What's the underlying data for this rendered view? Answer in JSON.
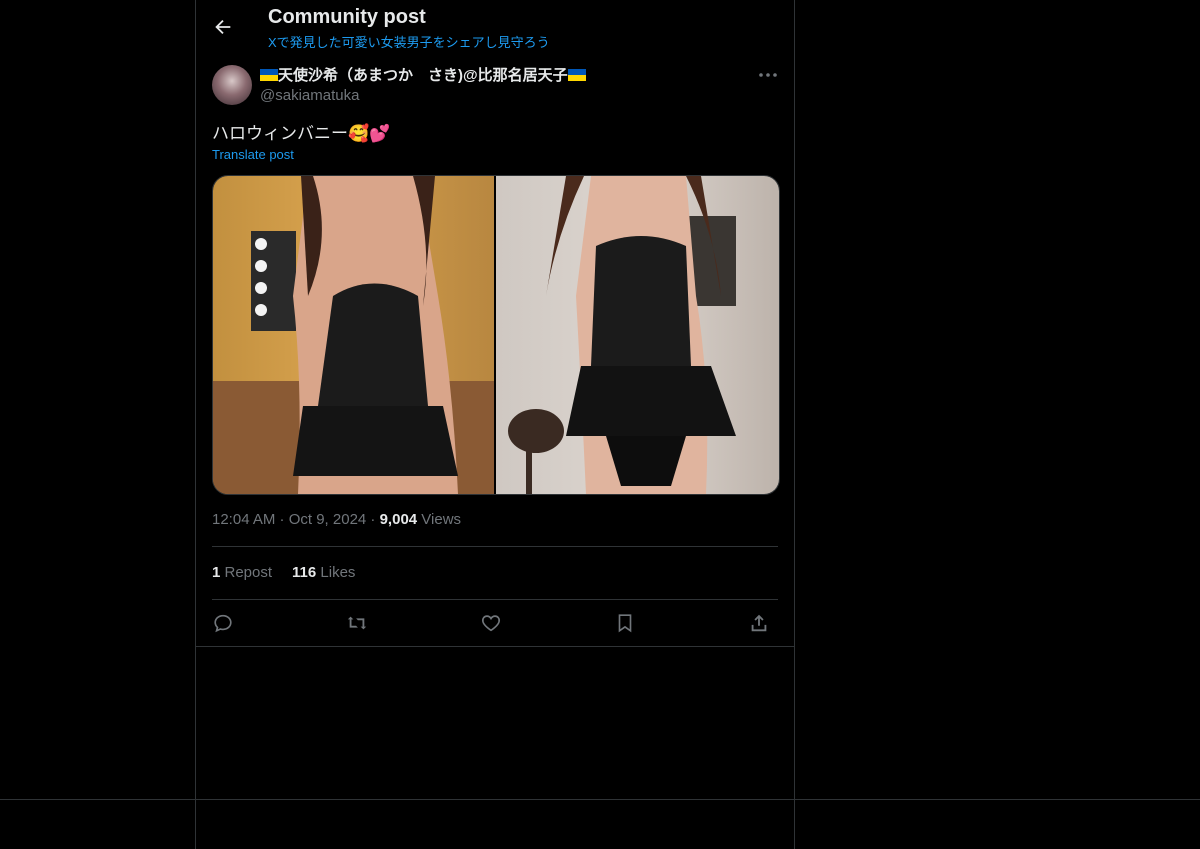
{
  "header": {
    "title": "Community post",
    "community_name": "Xで発見した可愛い女装男子をシェアし見守ろう"
  },
  "post": {
    "author_name": "天使沙希（あまつか　さき)@比那名居天子",
    "author_handle": "@sakiamatuka",
    "text": "ハロウィンバニー🥰💕",
    "translate_label": "Translate post",
    "timestamp": "12:04 AM · Oct 9, 2024 · ",
    "views_count": "9,004",
    "views_label": " Views",
    "repost_count": "1",
    "repost_label": " Repost",
    "likes_count": "116",
    "likes_label": " Likes"
  },
  "icons": {
    "back": "arrow-left-icon",
    "more": "more-horizontal-icon",
    "reply": "reply-icon",
    "retweet": "retweet-icon",
    "like": "heart-icon",
    "bookmark": "bookmark-icon",
    "share": "share-icon"
  },
  "colors": {
    "background": "#000000",
    "accent": "#1d9bf0",
    "text_primary": "#e7e9ea",
    "text_secondary": "#71767b",
    "border": "#2f3336"
  }
}
